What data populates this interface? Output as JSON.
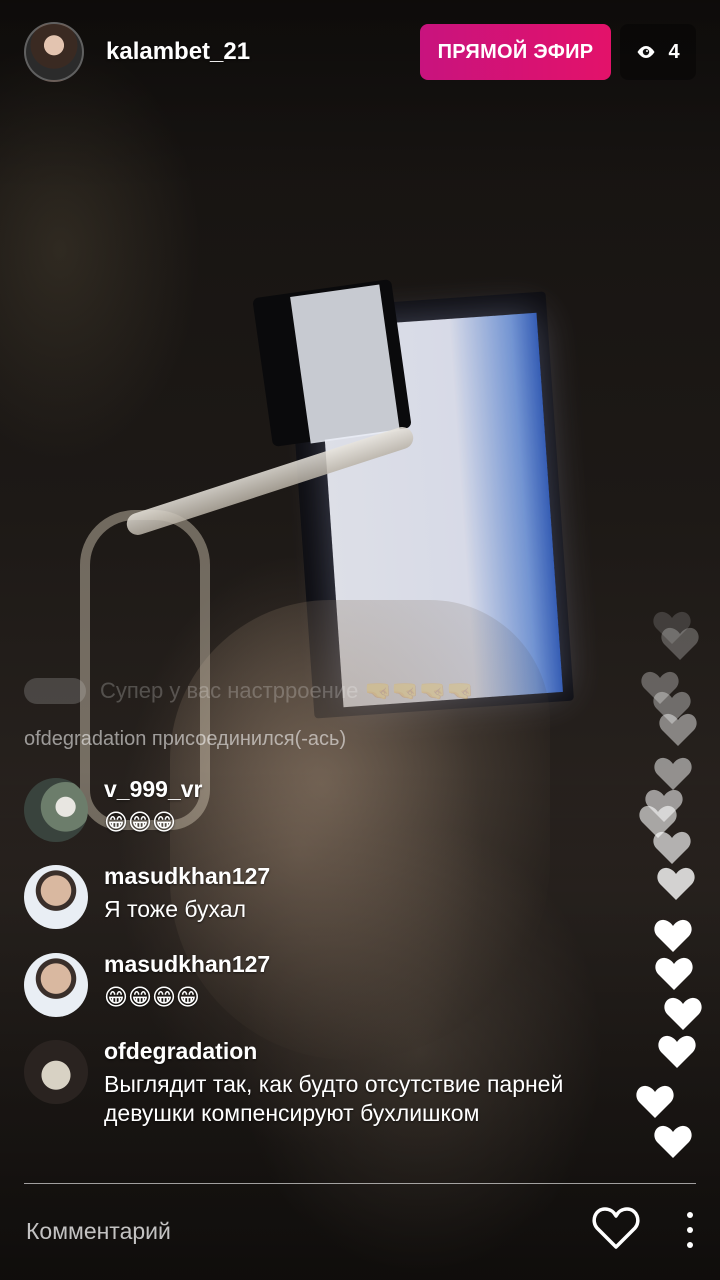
{
  "header": {
    "host_username": "kalambet_21",
    "live_label": "ПРЯМОЙ ЭФИР",
    "viewer_count": "4",
    "live_badge_color": "#d9127a"
  },
  "feed": {
    "faded_comment": "Супер у вас настрроение 🤜🤜🤜🤜",
    "join_notice": "ofdegradation присоединился(-ась)",
    "comments": [
      {
        "username": "v_999_vr",
        "text": "😁😁😁"
      },
      {
        "username": "masudkhan127",
        "text": "Я тоже бухал"
      },
      {
        "username": "masudkhan127",
        "text": "😁😁😁😁"
      },
      {
        "username": "ofdegradation",
        "text": "Выглядит так, как будто отсутствие парней девушки компенсируют бухлишком"
      }
    ]
  },
  "footer": {
    "comment_placeholder": "Комментарий",
    "like_icon": "heart-outline-icon",
    "more_icon": "more-vertical-icon"
  }
}
